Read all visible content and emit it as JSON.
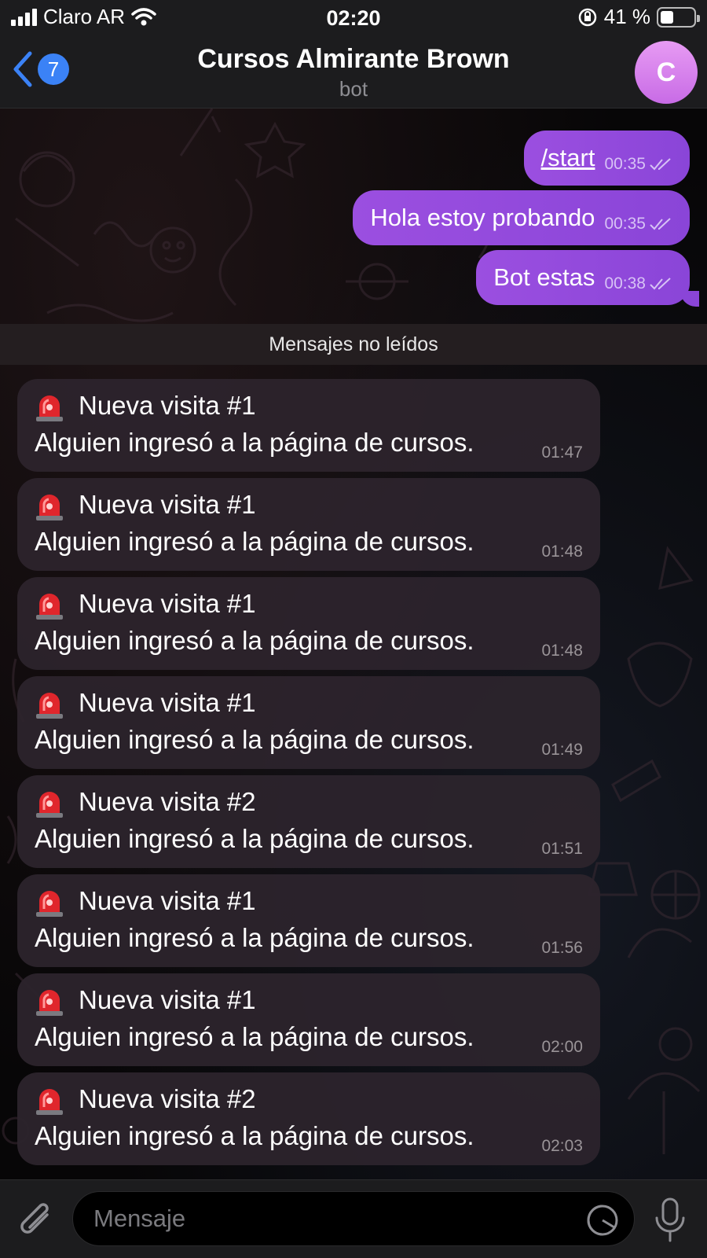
{
  "status_bar": {
    "carrier": "Claro AR",
    "time": "02:20",
    "battery_percent": "41 %",
    "battery_level": 0.41
  },
  "header": {
    "back_count": "7",
    "title": "Cursos Almirante Brown",
    "subtitle": "bot",
    "avatar_letter": "C"
  },
  "outgoing_messages": [
    {
      "text": "/start",
      "time": "00:35"
    },
    {
      "text": "Hola estoy probando",
      "time": "00:35"
    },
    {
      "text": "Bot estas",
      "time": "00:38"
    }
  ],
  "unread_divider": "Mensajes no leídos",
  "incoming_messages": [
    {
      "title": "Nueva visita #1",
      "body": "Alguien ingresó a la página de cursos.",
      "time": "01:47"
    },
    {
      "title": "Nueva visita #1",
      "body": "Alguien ingresó a la página de cursos.",
      "time": "01:48"
    },
    {
      "title": "Nueva visita #1",
      "body": "Alguien ingresó a la página de cursos.",
      "time": "01:48"
    },
    {
      "title": "Nueva visita #1",
      "body": "Alguien ingresó a la página de cursos.",
      "time": "01:49"
    },
    {
      "title": "Nueva visita #2",
      "body": "Alguien ingresó a la página de cursos.",
      "time": "01:51"
    },
    {
      "title": "Nueva visita #1",
      "body": "Alguien ingresó a la página de cursos.",
      "time": "01:56"
    },
    {
      "title": "Nueva visita #1",
      "body": "Alguien ingresó a la página de cursos.",
      "time": "02:00"
    },
    {
      "title": "Nueva visita #2",
      "body": "Alguien ingresó a la página de cursos.",
      "time": "02:03"
    }
  ],
  "input": {
    "placeholder": "Mensaje"
  },
  "icons": {
    "back": "chevron-left-icon",
    "attach": "paperclip-icon",
    "sticker": "sticker-icon",
    "mic": "microphone-icon",
    "message_prefix": "siren-emoji",
    "read_receipt": "double-check-icon"
  },
  "colors": {
    "outgoing_bubble": "#9b4fe0",
    "incoming_bubble": "#2c242c",
    "badge": "#3b82f6",
    "avatar": "#d683ee"
  }
}
